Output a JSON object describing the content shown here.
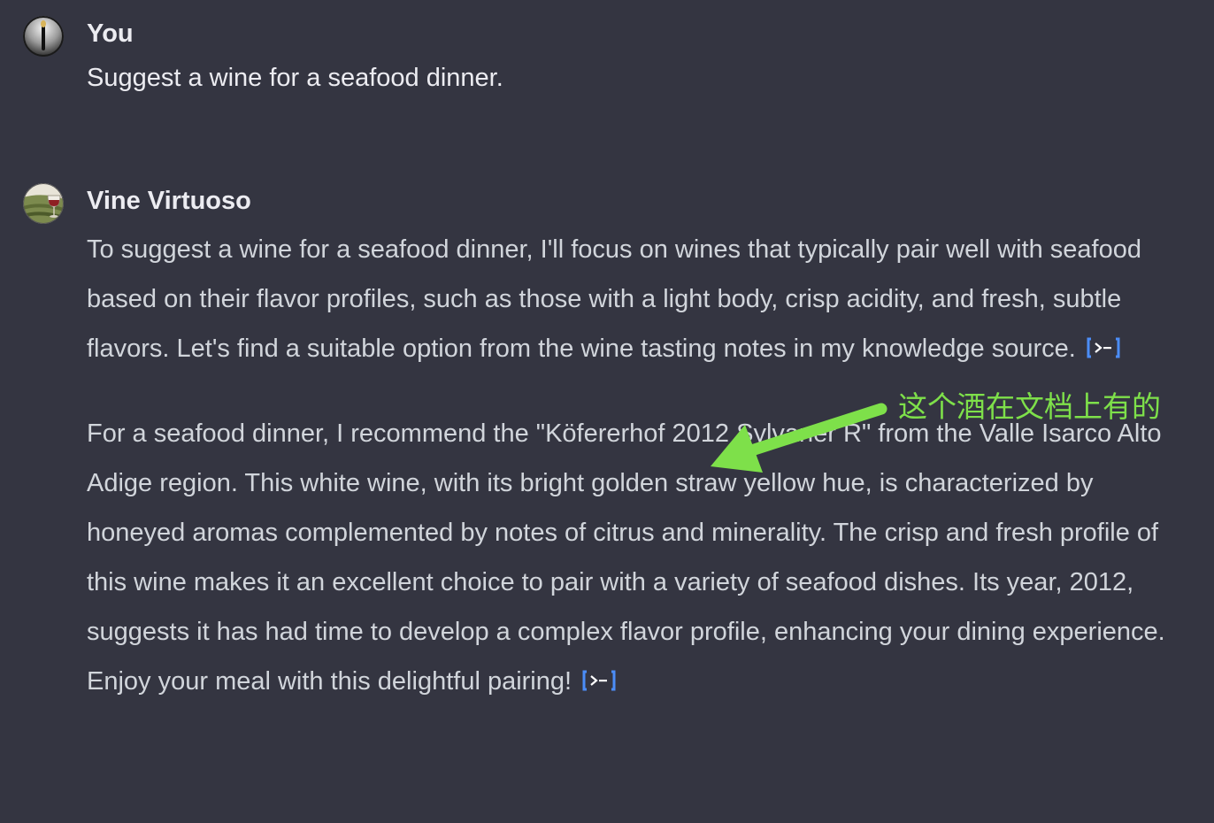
{
  "user_message": {
    "author": "You",
    "text": "Suggest a wine for a seafood dinner.",
    "avatar_icon": "candle-avatar-icon"
  },
  "assistant_message": {
    "author": "Vine Virtuoso",
    "avatar_icon": "vineyard-wine-glass-avatar-icon",
    "paragraphs": [
      "To suggest a wine for a seafood dinner, I'll focus on wines that typically pair well with seafood based on their flavor profiles, such as those with a light body, crisp acidity, and fresh, subtle flavors. Let's find a suitable option from the wine tasting notes in my knowledge source.",
      "For a seafood dinner, I recommend the \"Köfererhof 2012 Sylvaner R\" from the Valle Isarco Alto Adige region. This white wine, with its bright golden straw yellow hue, is characterized by honeyed aromas complemented by notes of citrus and minerality. The crisp and fresh profile of this wine makes it an excellent choice to pair with a variety of seafood dishes. Its year, 2012, suggests it has had time to develop a complex flavor profile, enhancing your dining experience. Enjoy your meal with this delightful pairing!"
    ],
    "citation_icon": "citation-source-icon"
  },
  "annotation": {
    "text": "这个酒在文档上有的",
    "color": "#7ee04a",
    "arrow_icon": "green-arrow-icon"
  },
  "colors": {
    "background": "#343541",
    "text_primary": "#ececf1",
    "text_body": "#d1d5db",
    "citation_blue": "#4b8df8"
  }
}
